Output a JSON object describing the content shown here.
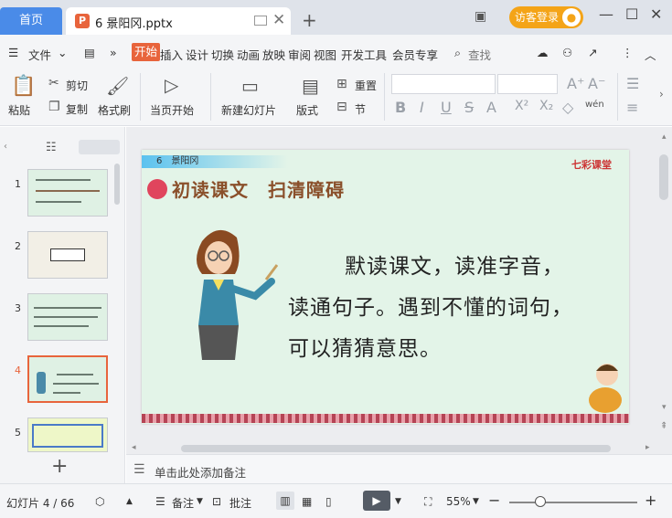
{
  "tabs": {
    "home": "首页",
    "doc": "6 景阳冈.pptx",
    "ppt_badge": "P"
  },
  "titlebar": {
    "login": "访客登录"
  },
  "menu": {
    "file": "文件",
    "items": [
      "开始",
      "插入",
      "设计",
      "切换",
      "动画",
      "放映",
      "审阅",
      "视图",
      "开发工具",
      "会员专享"
    ],
    "search": "查找"
  },
  "ribbon": {
    "paste": "粘贴",
    "cut": "剪切",
    "copy": "复制",
    "format_painter": "格式刷",
    "play_from_current": "当页开始",
    "new_slide": "新建幻灯片",
    "layout": "版式",
    "reset": "重置",
    "section": "节",
    "bold": "B",
    "italic": "I",
    "underline": "U",
    "strike": "S",
    "font_color": "A",
    "superscript": "X²",
    "subscript": "X₂",
    "pinyin": "wén"
  },
  "thumbs": [
    "1",
    "2",
    "3",
    "4",
    "5"
  ],
  "slide": {
    "lesson": "6　景阳冈",
    "logo": "七彩课堂",
    "title": "初读课文　扫清障碍",
    "lines": [
      "默读课文，读准字音，",
      "读通句子。遇到不懂的词句，",
      "可以猜猜意思。"
    ]
  },
  "notes": {
    "placeholder": "单击此处添加备注"
  },
  "status": {
    "slide_info": "幻灯片 4 / 66",
    "notes": "备注",
    "comments": "批注",
    "zoom": "55%"
  }
}
